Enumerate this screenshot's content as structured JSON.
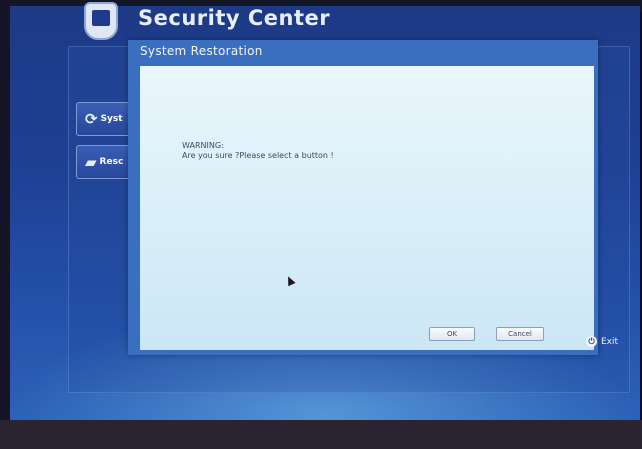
{
  "app": {
    "title": "Security Center"
  },
  "sidebar": {
    "items": [
      {
        "label": "Syst",
        "icon": "refresh-icon"
      },
      {
        "label": "Resc",
        "icon": "folder-icon"
      }
    ]
  },
  "dialog": {
    "title": "System  Restoration",
    "warning_title": "WARNING:",
    "warning_message": "Are you sure ?Please select a button !",
    "ok_label": "OK",
    "cancel_label": "Cancel"
  },
  "footer": {
    "exit_label": "Exit",
    "exit_icon": "power-icon"
  },
  "colors": {
    "screen_bg": "#1e3f93",
    "dialog_frame": "#3a6fbf",
    "dialog_body": "#d7eef8"
  }
}
